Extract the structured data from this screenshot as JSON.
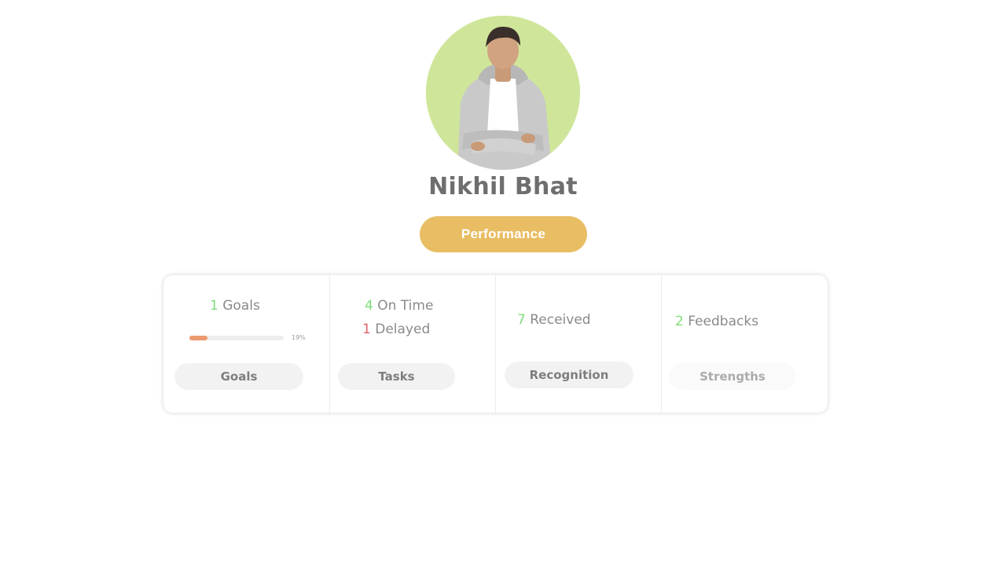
{
  "profile": {
    "name": "Nikhil Bhat",
    "avatar_bg": "#cfe69a"
  },
  "performance_button": {
    "label": "Performance",
    "color": "#e8bd63"
  },
  "stats": {
    "goals": {
      "count": "1",
      "label": "Goals",
      "progress_percent": 19,
      "progress_label": "19%",
      "button_label": "Goals"
    },
    "tasks": {
      "on_time_count": "4",
      "on_time_label": "On Time",
      "delayed_count": "1",
      "delayed_label": "Delayed",
      "button_label": "Tasks"
    },
    "recognition": {
      "received_count": "7",
      "received_label": "Received",
      "button_label": "Recognition"
    },
    "strengths": {
      "feedback_count": "2",
      "feedback_label": "Feedbacks",
      "button_label": "Strengths"
    }
  },
  "colors": {
    "count_positive": "#7fdc7a",
    "count_negative": "#e2606b",
    "progress_fill": "#eb9a6f"
  }
}
